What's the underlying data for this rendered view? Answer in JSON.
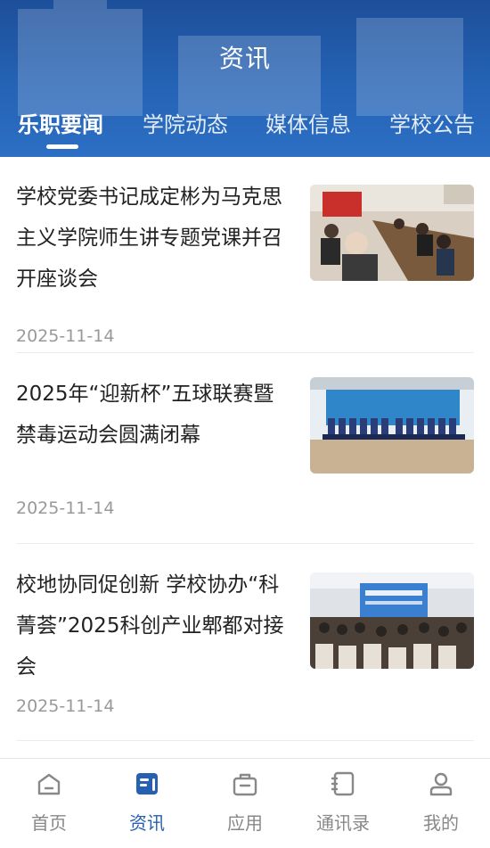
{
  "header": {
    "title": "资讯",
    "tabs": [
      {
        "label": "乐职要闻",
        "active": true
      },
      {
        "label": "学院动态",
        "active": false
      },
      {
        "label": "媒体信息",
        "active": false
      },
      {
        "label": "学校公告",
        "active": false
      }
    ]
  },
  "news": [
    {
      "title": "学校党委书记成定彬为马克思主义学院师生讲专题党课并召开座谈会",
      "date": "2025-11-14",
      "image": "meeting-room-photo"
    },
    {
      "title": "2025年“迎新杯”五球联赛暨禁毒运动会圆满闭幕",
      "date": "2025-11-14",
      "image": "sports-group-photo"
    },
    {
      "title": "校地协同促创新  学校协办“科菁荟”2025科创产业郫都对接会",
      "date": "2025-11-14",
      "image": "conference-hall-photo"
    }
  ],
  "tabbar": {
    "items": [
      {
        "label": "首页",
        "icon": "home-icon",
        "active": false
      },
      {
        "label": "资讯",
        "icon": "news-icon",
        "active": true
      },
      {
        "label": "应用",
        "icon": "briefcase-icon",
        "active": false
      },
      {
        "label": "通讯录",
        "icon": "contacts-book-icon",
        "active": false
      },
      {
        "label": "我的",
        "icon": "user-icon",
        "active": false
      }
    ]
  },
  "colors": {
    "primary": "#2660b0",
    "header_bg": "#2563b5",
    "inactive": "#888888"
  }
}
